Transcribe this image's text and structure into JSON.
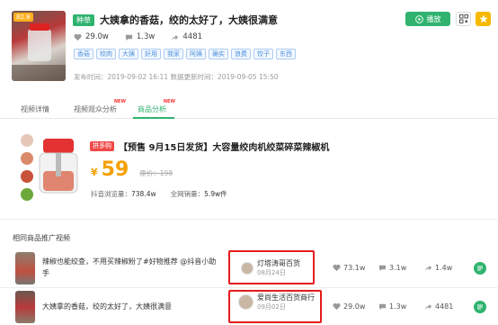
{
  "header": {
    "score": "82.8",
    "category_tag": "种草",
    "title": "大姨拿的香菇，绞的太好了，大姨很满意",
    "likes": "29.0w",
    "comments": "1.3w",
    "shares": "4481",
    "keywords": [
      "香菇",
      "绞肉",
      "大姨",
      "好用",
      "我家",
      "阿姨",
      "确实",
      "浪费",
      "饺子",
      "东西"
    ],
    "publish_label": "发布时间：",
    "publish_time": "2019-09-02 16:11",
    "update_label": "数据更新时间：",
    "update_time": "2019-09-05 15:50",
    "play_label": "播放"
  },
  "tabs": [
    {
      "label": "视频详情",
      "new": ""
    },
    {
      "label": "视频观众分析",
      "new": "NEW"
    },
    {
      "label": "商品分析",
      "new": "NEW"
    }
  ],
  "product": {
    "badge": "拼多购",
    "title": "【预售 9月15日发货】大容量绞肉机绞菜碎菜辣椒机",
    "currency": "¥",
    "price": "59",
    "old_price_label": "原价：",
    "old_price": "198",
    "views_label": "抖音浏览量：",
    "views": "738.4w",
    "sales_label": "全网销量：",
    "sales": "5.9w件"
  },
  "section_title": "相同商品推广视频",
  "videos": [
    {
      "title": "辣椒也能绞查，不用买辣椒粉了#好物推荐 @抖音小助手",
      "author": "灯塔涛哥百货",
      "date": "08月24日",
      "likes": "73.1w",
      "comments": "3.1w",
      "shares": "1.4w"
    },
    {
      "title": "大姨拿的香菇，绞的太好了，大姨很满意",
      "author": "爱尚生活百货商行",
      "date": "09月02日",
      "likes": "29.0w",
      "comments": "1.3w",
      "shares": "4481"
    }
  ],
  "colors": {
    "accent": "#2fb36f",
    "price": "#f5a000",
    "highlight": "#e51c1c",
    "keyword": "#4a8fdc"
  }
}
